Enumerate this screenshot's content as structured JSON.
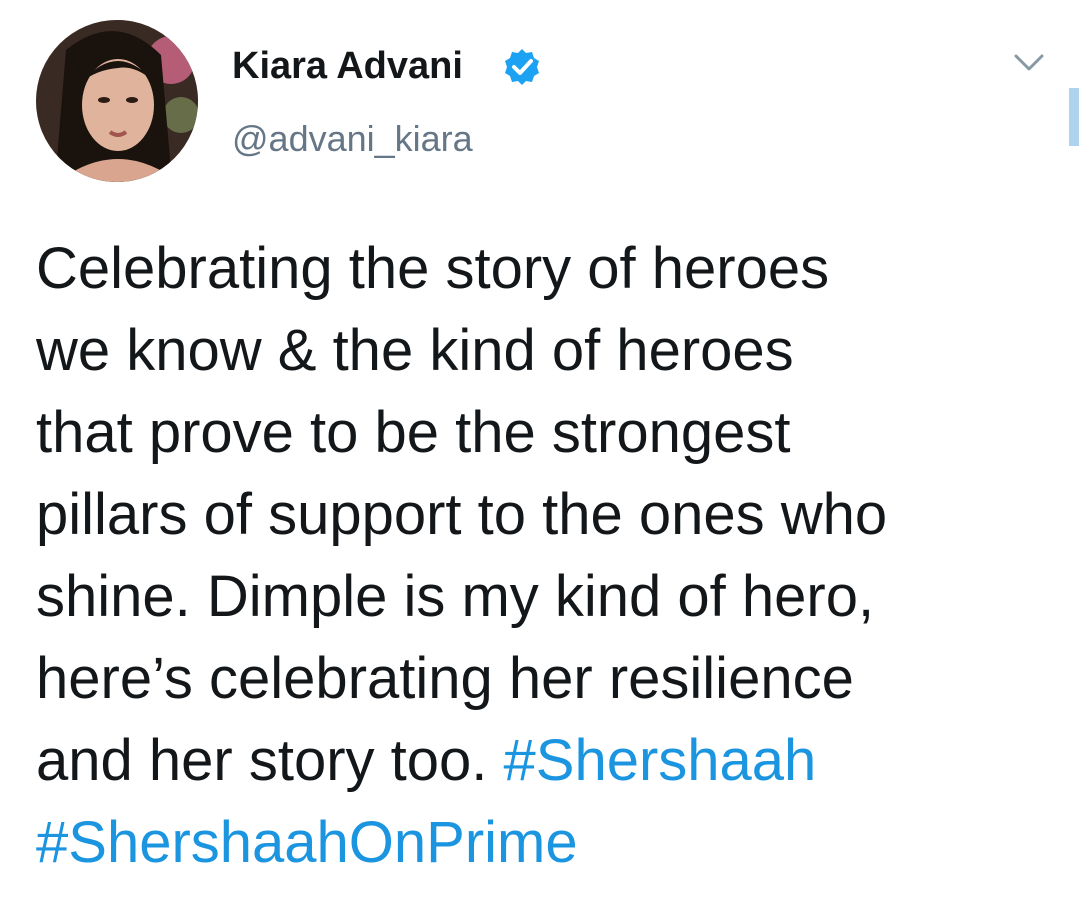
{
  "author": {
    "display_name": "Kiara Advani",
    "handle": "@advani_kiara",
    "verified": true,
    "avatar_icon": "profile-photo"
  },
  "menu": {
    "icon": "chevron-down-icon"
  },
  "tweet": {
    "lines": [
      "Celebrating the story of heroes",
      "we know & the kind of heroes",
      "that prove to be the strongest",
      "pillars of support to the ones who",
      "shine. Dimple is my kind of hero,",
      "here’s celebrating her resilience",
      "and her story too."
    ],
    "hashtags": [
      "#Shershaah",
      "#ShershaahOnPrime"
    ]
  },
  "colors": {
    "text": "#14171a",
    "secondary": "#657786",
    "link": "#1b95e0",
    "verified": "#1da1f2"
  }
}
